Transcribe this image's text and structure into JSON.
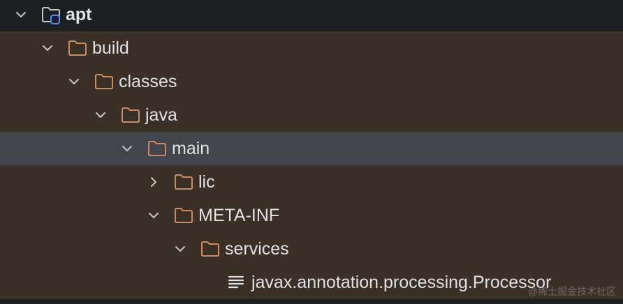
{
  "project_tree": {
    "nodes": [
      {
        "label": "apt",
        "depth": 0,
        "expanded": true,
        "icon": "module-folder-icon",
        "state": "root"
      },
      {
        "label": "build",
        "depth": 1,
        "expanded": true,
        "icon": "folder-icon",
        "state": "excluded"
      },
      {
        "label": "classes",
        "depth": 2,
        "expanded": true,
        "icon": "folder-icon",
        "state": "excluded"
      },
      {
        "label": "java",
        "depth": 3,
        "expanded": true,
        "icon": "folder-icon",
        "state": "excluded"
      },
      {
        "label": "main",
        "depth": 4,
        "expanded": true,
        "icon": "folder-icon",
        "state": "selected"
      },
      {
        "label": "lic",
        "depth": 5,
        "expanded": false,
        "icon": "folder-icon",
        "state": "excluded"
      },
      {
        "label": "META-INF",
        "depth": 5,
        "expanded": true,
        "icon": "folder-icon",
        "state": "excluded"
      },
      {
        "label": "services",
        "depth": 6,
        "expanded": true,
        "icon": "folder-icon",
        "state": "excluded"
      },
      {
        "label": "javax.annotation.processing.Processor",
        "depth": 7,
        "expanded": null,
        "icon": "text-file-icon",
        "state": "excluded"
      }
    ]
  },
  "watermark": "@稀土掘金技术社区",
  "colors": {
    "background": "#1e1f22",
    "excluded_row": "#3a3026",
    "selected_row": "#43454a",
    "folder_excluded": "#d08a62",
    "module_folder": "#c4c6cc",
    "module_badge": "#548af7",
    "text": "#dfe1e5"
  }
}
